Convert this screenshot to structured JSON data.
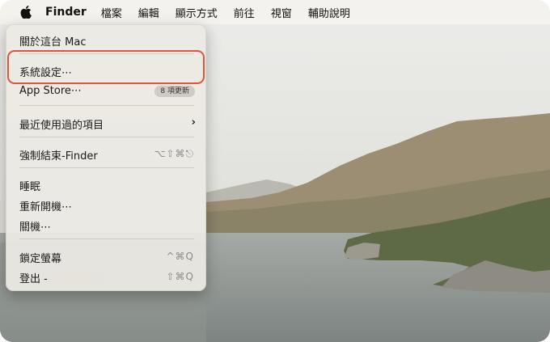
{
  "menubar": {
    "app_name": "Finder",
    "items": [
      "檔案",
      "編輯",
      "顯示方式",
      "前往",
      "視窗",
      "輔助說明"
    ]
  },
  "apple_menu": {
    "about": "關於這台 Mac",
    "system_settings": "系統設定⋯",
    "app_store": "App Store⋯",
    "app_store_badge": "8 項更新",
    "recent_items": "最近使用過的項目",
    "force_quit": "強制結束-Finder",
    "force_quit_shortcut": "⌥⇧⌘⎋",
    "sleep": "睡眠",
    "restart": "重新開機⋯",
    "shutdown": "關機⋯",
    "lock_screen": "鎖定螢幕",
    "lock_screen_shortcut": "^⌘Q",
    "logout": "登出 -",
    "logout_shortcut": "⇧⌘Q"
  },
  "colors": {
    "highlight_border": "#e0553a",
    "sky": "#dcdcd5",
    "sea": "#8c9290"
  }
}
